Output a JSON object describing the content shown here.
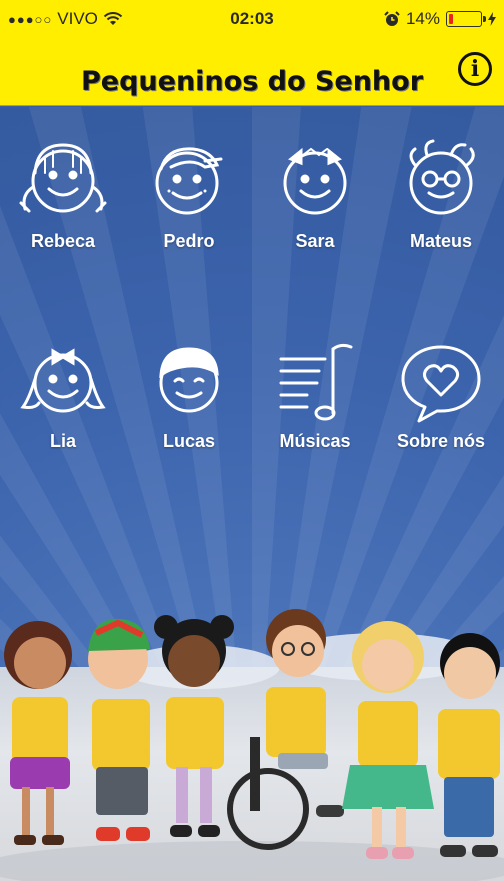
{
  "status_bar": {
    "carrier": "VIVO",
    "time": "02:03",
    "battery_percent": "14%",
    "battery_level": 0.14,
    "battery_color": "#e8261b"
  },
  "nav": {
    "title": "Pequeninos do Senhor",
    "info_icon": "info-icon"
  },
  "colors": {
    "header_yellow": "#ffee00",
    "background_blue": "#3c64ad"
  },
  "menu": {
    "items": [
      {
        "label": "Rebeca",
        "icon": "girl-pigtails-face-icon"
      },
      {
        "label": "Pedro",
        "icon": "boy-cap-face-icon"
      },
      {
        "label": "Sara",
        "icon": "girl-bows-face-icon"
      },
      {
        "label": "Mateus",
        "icon": "boy-glasses-face-icon"
      },
      {
        "label": "Lia",
        "icon": "girl-bow-face-icon"
      },
      {
        "label": "Lucas",
        "icon": "boy-hair-face-icon"
      },
      {
        "label": "Músicas",
        "icon": "music-note-icon"
      },
      {
        "label": "Sobre nós",
        "icon": "heart-speech-bubble-icon"
      }
    ]
  }
}
